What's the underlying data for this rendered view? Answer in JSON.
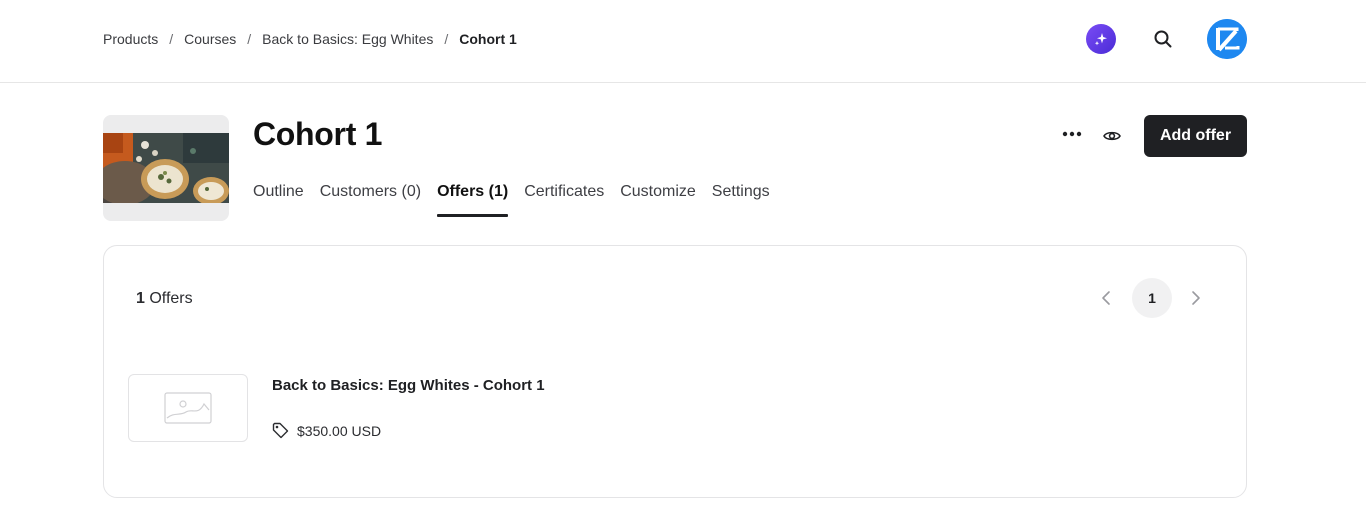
{
  "breadcrumb": {
    "items": [
      "Products",
      "Courses",
      "Back to Basics: Egg Whites"
    ],
    "separator": "/",
    "current": "Cohort 1"
  },
  "header": {
    "title": "Cohort 1",
    "add_offer_label": "Add offer"
  },
  "tabs": [
    {
      "label": "Outline",
      "active": false
    },
    {
      "label": "Customers (0)",
      "active": false
    },
    {
      "label": "Offers (1)",
      "active": true
    },
    {
      "label": "Certificates",
      "active": false
    },
    {
      "label": "Customize",
      "active": false
    },
    {
      "label": "Settings",
      "active": false
    }
  ],
  "offers": {
    "count": "1",
    "count_label": "Offers",
    "current_page": "1",
    "items": [
      {
        "name": "Back to Basics: Egg Whites - Cohort 1",
        "price": "$350.00 USD"
      }
    ]
  },
  "icons": {
    "ai": "sparkle-icon",
    "search": "search-icon",
    "avatar": "brand-logo",
    "more": "more-horizontal-icon",
    "preview": "eye-icon",
    "prev": "chevron-left-icon",
    "next": "chevron-right-icon",
    "price": "price-tag-icon",
    "placeholder": "image-placeholder-icon"
  },
  "colors": {
    "primary_button": "#1f2023",
    "ai_gradient": "#6a3ff0",
    "avatar": "#1e88f0"
  }
}
